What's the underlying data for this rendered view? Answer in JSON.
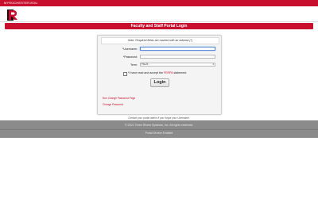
{
  "topbar": {
    "site_link": "MYROCHESTER.EDU"
  },
  "logo": {
    "icon": "university-r-logo"
  },
  "header": {
    "title": "Faculty and Staff Portal Login"
  },
  "form": {
    "note": "Note: Required fields are marked with an asterisk (*)",
    "username_label": "*Username:",
    "password_label": "*Password:",
    "term_label": "Term:",
    "term_selected": "FA-21",
    "ferpa_text_before": "*I have read and accept the ",
    "ferpa_link": "FERPA",
    "ferpa_text_after": " statement.",
    "login_button": "Login",
    "non_change_password_link": "Non Change Password Page",
    "change_password_link": "Change Password"
  },
  "help_text": "Contact your portal admin if you forgot your Username.",
  "footer": {
    "copyright": "© 2021 Three Rivers Systems, Inc. All rights reserved.",
    "service": "Portal Service Enabled"
  },
  "colors": {
    "brand_red": "#c8102e",
    "footer_gray": "#8b8b8b"
  }
}
